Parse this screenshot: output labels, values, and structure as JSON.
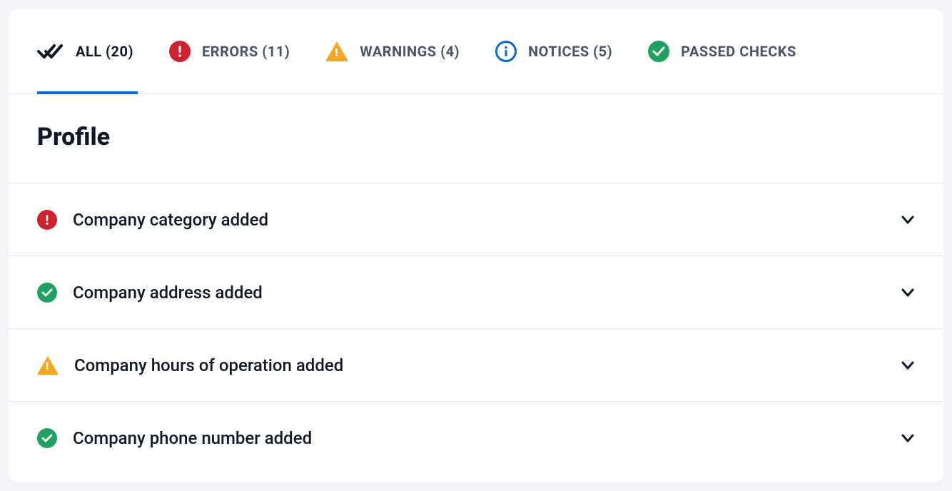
{
  "tabs": {
    "all": {
      "label": "ALL (20)"
    },
    "errors": {
      "label": "ERRORS (11)"
    },
    "warnings": {
      "label": "WARNINGS (4)"
    },
    "notices": {
      "label": "NOTICES (5)"
    },
    "passed": {
      "label": "PASSED CHECKS"
    }
  },
  "section": {
    "title": "Profile"
  },
  "rows": [
    {
      "label": "Company category added",
      "status": "error"
    },
    {
      "label": "Company address added",
      "status": "passed"
    },
    {
      "label": "Company hours of operation added",
      "status": "warning"
    },
    {
      "label": "Company phone number added",
      "status": "passed"
    }
  ],
  "colors": {
    "error": "#cf212e",
    "passed": "#1fa261",
    "warning": "#f5a623",
    "notice": "#0969da",
    "accent": "#0969da"
  }
}
